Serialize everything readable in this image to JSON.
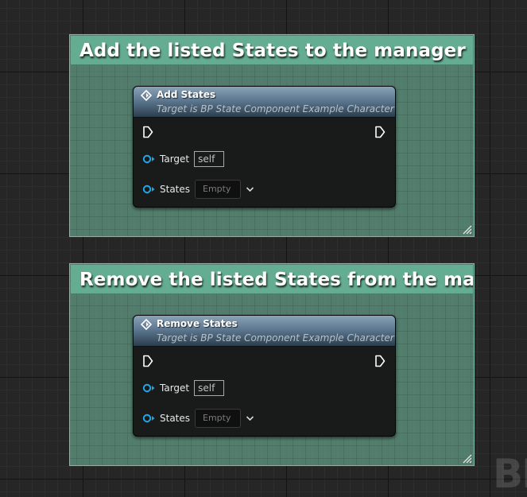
{
  "colors": {
    "graph_background": "#262626",
    "comment_title_bar": "#64ad93",
    "comment_body": "#5f9682",
    "node_header": "#5d7890",
    "object_pin": "#1fa8e6"
  },
  "comments": [
    {
      "title": "Add the listed States to the manager",
      "node": {
        "title": "Add States",
        "subtitle": "Target is BP State Component Example Character",
        "target_label": "Target",
        "target_value": "self",
        "states_label": "States",
        "states_value": "Empty"
      }
    },
    {
      "title": "Remove the listed States from the manager",
      "node": {
        "title": "Remove States",
        "subtitle": "Target is BP State Component Example Character",
        "target_label": "Target",
        "target_value": "self",
        "states_label": "States",
        "states_value": "Empty"
      }
    }
  ],
  "icons": [
    "function-icon",
    "exec-pin-icon",
    "object-pin-icon",
    "chevron-down-icon",
    "resize-handle-icon"
  ],
  "watermark": "BI"
}
